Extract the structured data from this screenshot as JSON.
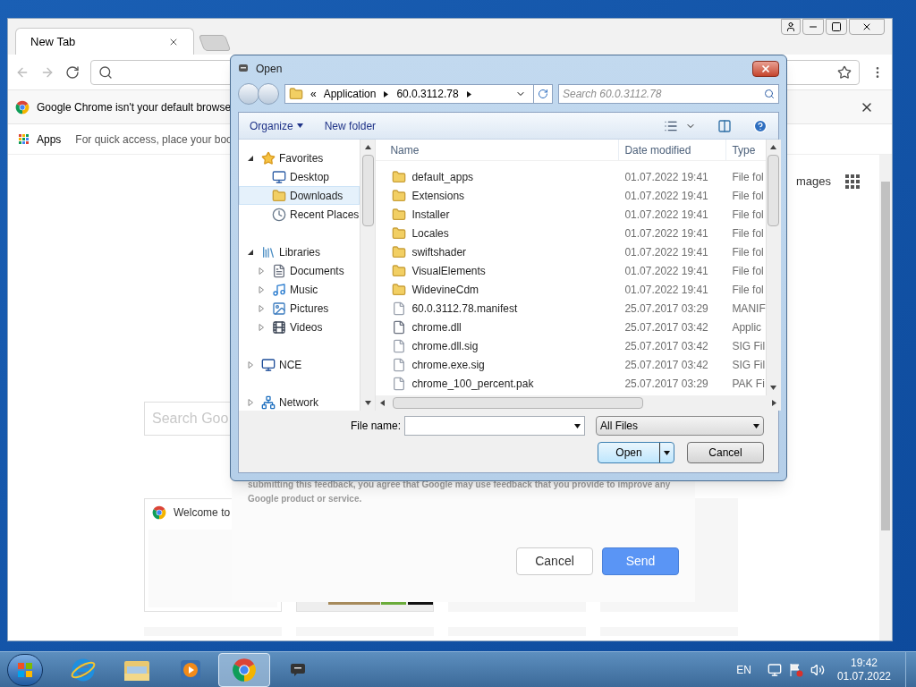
{
  "chrome": {
    "tabs": [
      {
        "title": "New Tab",
        "selected": true
      }
    ],
    "infobar": {
      "text": "Google Chrome isn't your default browse"
    },
    "bookmarks": {
      "apps": "Apps",
      "hint": "For quick access, place your boo"
    },
    "images_link": "mages",
    "search": {
      "placeholder": "Search Goo"
    },
    "tiles": [
      {
        "kind": "site",
        "title": "Welcome to"
      },
      {
        "kind": "picture"
      },
      {
        "kind": "blank"
      },
      {
        "kind": "blank"
      }
    ]
  },
  "feedback": {
    "text": "submitting this feedback, you agree that Google may use feedback that you provide to improve any Google product or service.",
    "buttons": [
      {
        "label": "Cancel",
        "kind": "secondary"
      },
      {
        "label": "Send",
        "kind": "primary"
      }
    ]
  },
  "dialog": {
    "title": "Open",
    "breadcrumb": [
      "«",
      "Application",
      "60.0.3112.78"
    ],
    "search": {
      "placeholder": "Search 60.0.3112.78"
    },
    "toolbar": {
      "organize": "Organize",
      "new_folder": "New folder"
    },
    "tree": [
      {
        "label": "Favorites",
        "kind": "star",
        "expanded": true,
        "selected": false,
        "children": [
          {
            "label": "Desktop",
            "kind": "desktop",
            "selected": false
          },
          {
            "label": "Downloads",
            "kind": "folder",
            "selected": true
          },
          {
            "label": "Recent Places",
            "kind": "recent",
            "selected": false
          }
        ]
      },
      {
        "label": "Libraries",
        "kind": "library",
        "expanded": true,
        "selected": false,
        "children": [
          {
            "label": "Documents",
            "kind": "document",
            "expanded": false,
            "selected": false
          },
          {
            "label": "Music",
            "kind": "music",
            "expanded": false,
            "selected": false
          },
          {
            "label": "Pictures",
            "kind": "pictures",
            "expanded": false,
            "selected": false
          },
          {
            "label": "Videos",
            "kind": "videos",
            "expanded": false,
            "selected": false
          }
        ]
      },
      {
        "label": "NCE",
        "kind": "computer",
        "expanded": false,
        "selected": false
      },
      {
        "label": "Network",
        "kind": "network",
        "expanded": false,
        "selected": false
      }
    ],
    "columns": [
      "Name",
      "Date modified",
      "Type"
    ],
    "rows": [
      {
        "kind": "folder",
        "name": "default_apps",
        "date": "01.07.2022 19:41",
        "type": "File fol"
      },
      {
        "kind": "folder",
        "name": "Extensions",
        "date": "01.07.2022 19:41",
        "type": "File fol"
      },
      {
        "kind": "folder",
        "name": "Installer",
        "date": "01.07.2022 19:41",
        "type": "File fol"
      },
      {
        "kind": "folder",
        "name": "Locales",
        "date": "01.07.2022 19:41",
        "type": "File fol"
      },
      {
        "kind": "folder",
        "name": "swiftshader",
        "date": "01.07.2022 19:41",
        "type": "File fol"
      },
      {
        "kind": "folder",
        "name": "VisualElements",
        "date": "01.07.2022 19:41",
        "type": "File fol"
      },
      {
        "kind": "folder",
        "name": "WidevineCdm",
        "date": "01.07.2022 19:41",
        "type": "File fol"
      },
      {
        "kind": "file",
        "name": "60.0.3112.78.manifest",
        "date": "25.07.2017 03:29",
        "type": "MANIF"
      },
      {
        "kind": "dll",
        "name": "chrome.dll",
        "date": "25.07.2017 03:42",
        "type": "Applic"
      },
      {
        "kind": "file",
        "name": "chrome.dll.sig",
        "date": "25.07.2017 03:42",
        "type": "SIG Fil"
      },
      {
        "kind": "file",
        "name": "chrome.exe.sig",
        "date": "25.07.2017 03:42",
        "type": "SIG Fil"
      },
      {
        "kind": "file",
        "name": "chrome_100_percent.pak",
        "date": "25.07.2017 03:29",
        "type": "PAK Fi"
      }
    ],
    "file_name_label": "File name:",
    "filter": "All Files",
    "buttons": [
      {
        "label": "Open",
        "kind": "split"
      },
      {
        "label": "Cancel",
        "kind": "plain"
      }
    ]
  },
  "taskbar": {
    "apps": [
      {
        "kind": "ie",
        "selected": false
      },
      {
        "kind": "explorer",
        "selected": false
      },
      {
        "kind": "media",
        "selected": false
      },
      {
        "kind": "chrome",
        "selected": true
      },
      {
        "kind": "feedback",
        "selected": false
      }
    ],
    "language": "EN",
    "time": "19:42",
    "date": "01.07.2022"
  }
}
